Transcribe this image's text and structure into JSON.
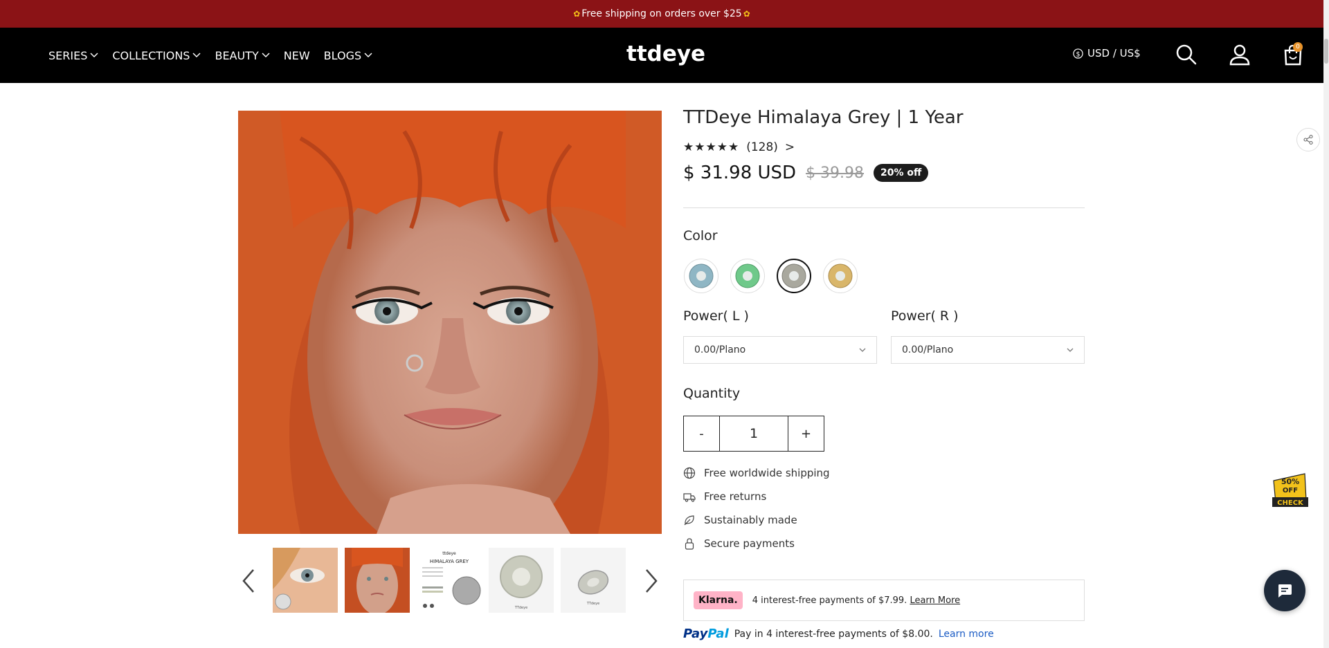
{
  "announcement": {
    "text": "Free shipping on orders over $25",
    "icon": "sunflower-icon"
  },
  "nav": {
    "links": [
      {
        "label": "SERIES",
        "dropdown": true
      },
      {
        "label": "COLLECTIONS",
        "dropdown": true
      },
      {
        "label": "BEAUTY",
        "dropdown": true
      },
      {
        "label": "NEW",
        "dropdown": false
      },
      {
        "label": "BLOGS",
        "dropdown": true
      }
    ],
    "logo": "ttdeye",
    "currency": "USD / US$",
    "cart_count": "0"
  },
  "product": {
    "title": "TTDeye Himalaya Grey | 1 Year",
    "stars": "★★★★★",
    "reviews": "(128)",
    "reviews_arrow": ">",
    "price": "$ 31.98 USD",
    "old_price": "$ 39.98",
    "discount": "20% off",
    "color_label": "Color",
    "colors": [
      {
        "name": "blue",
        "hex": "#8fb6c4",
        "selected": false
      },
      {
        "name": "green",
        "hex": "#6fc98a",
        "selected": false
      },
      {
        "name": "grey",
        "hex": "#a9a89e",
        "selected": true
      },
      {
        "name": "honey",
        "hex": "#d9b66a",
        "selected": false
      }
    ],
    "power_left_label": "Power( L )",
    "power_right_label": "Power( R )",
    "power_left_value": "0.00/Plano",
    "power_right_value": "0.00/Plano",
    "quantity_label": "Quantity",
    "quantity": "1",
    "qty_minus": "-",
    "qty_plus": "+",
    "features": [
      {
        "icon": "globe-icon",
        "text": "Free worldwide shipping"
      },
      {
        "icon": "truck-icon",
        "text": "Free returns"
      },
      {
        "icon": "leaf-icon",
        "text": "Sustainably made"
      },
      {
        "icon": "lock-icon",
        "text": "Secure payments"
      }
    ],
    "klarna": {
      "badge": "Klarna.",
      "text": "4 interest-free payments of $7.99.",
      "link": "Learn More"
    },
    "paypal": {
      "logo_a": "Pay",
      "logo_b": "Pal",
      "text": "Pay in 4 interest-free payments of $8.00.",
      "link": "Learn more"
    }
  },
  "gallery": {
    "thumbs": [
      "thumb-eye-closeup",
      "thumb-model",
      "thumb-package",
      "thumb-lens",
      "thumb-lens-case"
    ],
    "thumb_package_brand": "ttdeye",
    "thumb_package_name": "HIMALAYA GREY",
    "thumb_lens_brand": "TTdeye"
  },
  "promo": {
    "line1": "50%",
    "line2": "OFF",
    "line3": "CHECK"
  }
}
